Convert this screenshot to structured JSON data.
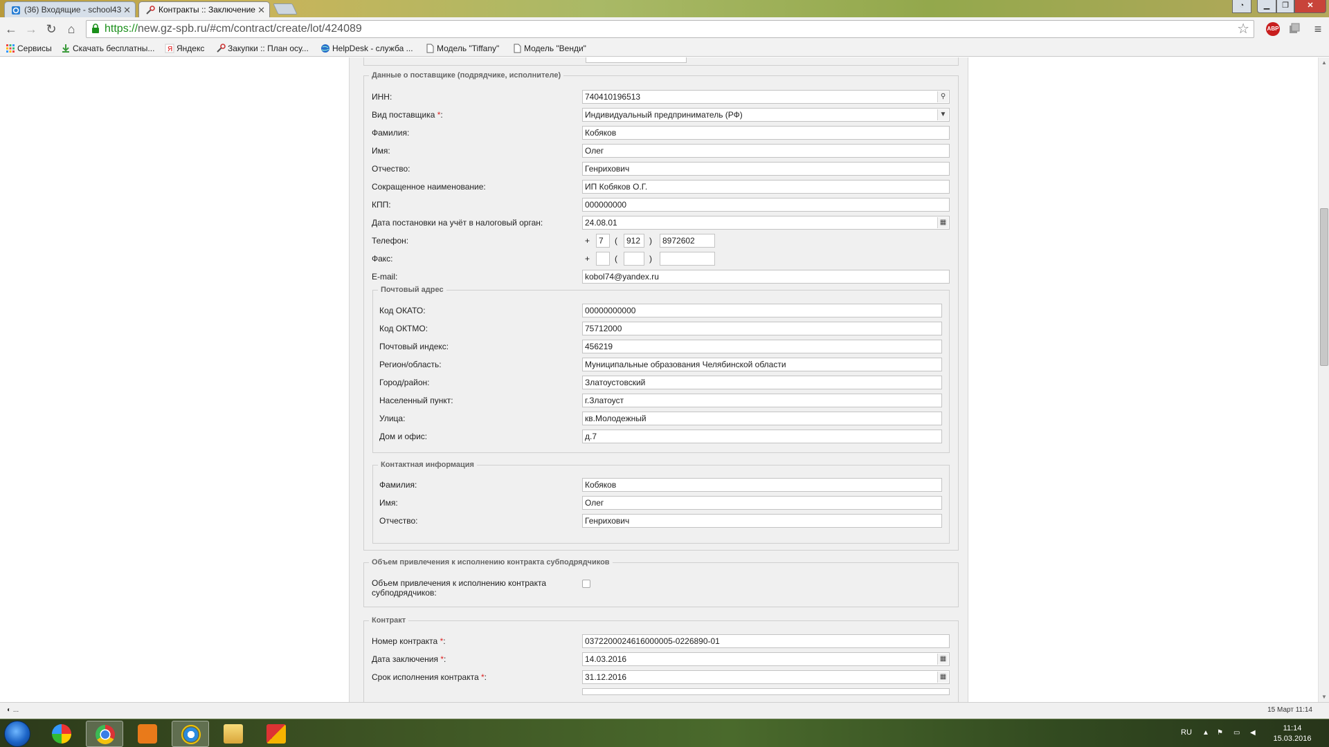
{
  "browser": {
    "tabs": [
      {
        "title": "(36) Входящие - school43",
        "active": false,
        "icon": "mail-icon"
      },
      {
        "title": "Контракты :: Заключение",
        "active": true,
        "icon": "tools-icon"
      }
    ],
    "url_scheme": "https://",
    "url_rest": "new.gz-spb.ru/#cm/contract/create/lot/424089",
    "bookmarks": [
      {
        "label": "Сервисы",
        "icon": "apps-grid-icon"
      },
      {
        "label": "Скачать бесплатны...",
        "icon": "download-icon"
      },
      {
        "label": "Яндекс",
        "icon": "yandex-icon"
      },
      {
        "label": "Закупки :: План осу...",
        "icon": "tools-icon"
      },
      {
        "label": "HelpDesk - служба ...",
        "icon": "globe-icon"
      },
      {
        "label": "Модель \"Tiffany\"",
        "icon": "page-icon"
      },
      {
        "label": "Модель \"Венди\"",
        "icon": "page-icon"
      }
    ],
    "abp_label": "ABP"
  },
  "form": {
    "supplier_legend": "Данные о поставщике (подрядчике, исполнителе)",
    "inn_label": "ИНН:",
    "inn_value": "740410196513",
    "type_label": "Вид поставщика",
    "type_value": "Индивидуальный предприниматель (РФ)",
    "lastname_label": "Фамилия:",
    "lastname_value": "Кобяков",
    "firstname_label": "Имя:",
    "firstname_value": "Олег",
    "middlename_label": "Отчество:",
    "middlename_value": "Генрихович",
    "shortname_label": "Сокращенное наименование:",
    "shortname_value": "ИП Кобяков О.Г.",
    "kpp_label": "КПП:",
    "kpp_value": "000000000",
    "taxdate_label": "Дата постановки на учёт в налоговый орган:",
    "taxdate_value": "24.08.01",
    "phone_label": "Телефон:",
    "phone_country": "7",
    "phone_code": "912",
    "phone_number": "8972602",
    "fax_label": "Факс:",
    "fax_country": "",
    "fax_code": "",
    "fax_number": "",
    "email_label": "E-mail:",
    "email_value": "kobol74@yandex.ru",
    "plus_symbol": "+",
    "open_paren": "(",
    "close_paren": ")",
    "required_mark": "*",
    "colon": ":",
    "postal": {
      "legend": "Почтовый адрес",
      "okato_label": "Код ОКАТО:",
      "okato_value": "00000000000",
      "oktmo_label": "Код ОКТМО:",
      "oktmo_value": "75712000",
      "index_label": "Почтовый индекс:",
      "index_value": "456219",
      "region_label": "Регион/область:",
      "region_value": "Муниципальные образования Челябинской области",
      "city_label": "Город/район:",
      "city_value": "Златоустовский",
      "locality_label": "Населенный пункт:",
      "locality_value": "г.Златоуст",
      "street_label": "Улица:",
      "street_value": "кв.Молодежный",
      "house_label": "Дом и офис:",
      "house_value": "д.7"
    },
    "contact": {
      "legend": "Контактная информация",
      "lastname_label": "Фамилия:",
      "lastname_value": "Кобяков",
      "firstname_label": "Имя:",
      "firstname_value": "Олег",
      "middlename_label": "Отчество:",
      "middlename_value": "Генрихович"
    },
    "subcontract_legend": "Объем привлечения к исполнению контракта субподрядчиков",
    "subcontract_label_1": "Объем привлечения к исполнению контракта",
    "subcontract_label_2": "субподрядчиков:",
    "contract": {
      "legend": "Контракт",
      "number_label": "Номер контракта",
      "number_value": "0372200024616000005-0226890-01",
      "date_label": "Дата заключения",
      "date_value": "14.03.2016",
      "term_label": "Срок исполнения контракта",
      "term_value": "31.12.2016"
    }
  },
  "status": {
    "left": "◐ ...",
    "right": "15 Март 11:14"
  },
  "taskbar": {
    "lang": "RU",
    "time": "11:14",
    "date": "15.03.2016"
  }
}
